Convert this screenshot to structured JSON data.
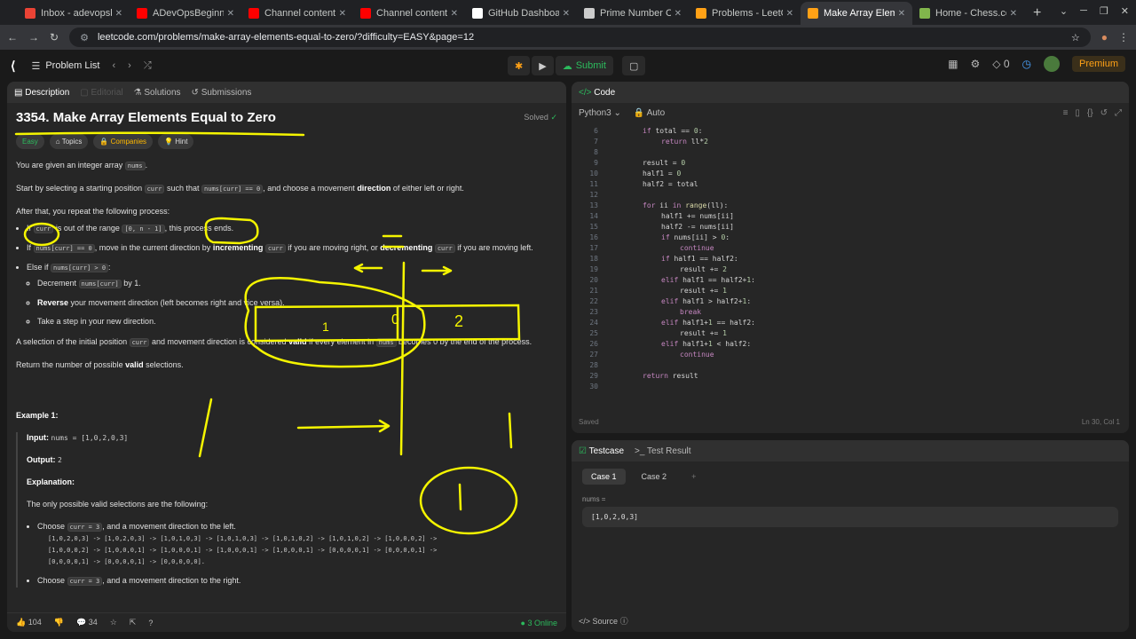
{
  "browser": {
    "tabs": [
      {
        "title": "Inbox - adevopsb",
        "color": "#ea4335"
      },
      {
        "title": "ADevOpsBeginne",
        "color": "#ff0000"
      },
      {
        "title": "Channel content",
        "color": "#ff0000"
      },
      {
        "title": "Channel content",
        "color": "#ff0000"
      },
      {
        "title": "GitHub Dashboar",
        "color": "#ffffff"
      },
      {
        "title": "Prime Number Ch",
        "color": "#cccccc"
      },
      {
        "title": "Problems - LeetC",
        "color": "#ffa116"
      },
      {
        "title": "Make Array Elem",
        "color": "#ffa116"
      },
      {
        "title": "Home - Chess.co",
        "color": "#81b64c"
      }
    ],
    "url": "leetcode.com/problems/make-array-elements-equal-to-zero/?difficulty=EASY&page=12"
  },
  "header": {
    "problem_list": "Problem List",
    "submit": "Submit",
    "notif_count": "0",
    "premium": "Premium"
  },
  "left_tabs": {
    "description": "Description",
    "editorial": "Editorial",
    "solutions": "Solutions",
    "submissions": "Submissions"
  },
  "problem": {
    "title": "3354. Make Array Elements Equal to Zero",
    "solved": "Solved",
    "difficulty": "Easy",
    "topics": "Topics",
    "companies": "Companies",
    "hint": "Hint",
    "p1": "You are given an integer array",
    "p2a": "Start by selecting a starting position",
    "p2b": "such that",
    "p2c": ", and choose a movement",
    "p2d": "direction",
    "p2e": "of either left or right.",
    "p3": "After that, you repeat the following process:",
    "b1a": "is out of the range",
    "b1b": ", this process ends.",
    "b2a": "If",
    "b2b": ", move in the current direction by",
    "b2c": "incrementing",
    "b2d": "if you are moving right, or",
    "b2e": "decrementing",
    "b2f": "if you are moving left.",
    "b3": "Else if",
    "b3_1a": "Decrement",
    "b3_1b": "by 1.",
    "b3_2a": "Reverse",
    "b3_2b": "your movement direction (left becomes right and vice versa).",
    "b3_3": "Take a step in your new direction.",
    "p4a": "A selection of the initial position",
    "p4b": "and movement direction is considered",
    "p4c": "valid",
    "p4d": "if every element in",
    "p4e": "becomes 0 by the end of the process.",
    "p5a": "Return the number of possible",
    "p5b": "valid",
    "p5c": "selections.",
    "code_nums": "nums",
    "code_curr": "curr",
    "code_eq0": "nums[curr] == 0",
    "code_range": "[0, n - 1]",
    "code_gt0": "nums[curr] > 0",
    "code_numscurr": "nums[curr]",
    "example_title": "Example 1:",
    "input_label": "Input:",
    "input_val": "nums = [1,0,2,0,3]",
    "output_label": "Output:",
    "output_val": "2",
    "expl_label": "Explanation:",
    "expl_text": "The only possible valid selections are the following:",
    "choose1a": "Choose",
    "choose_curr": "curr = 3",
    "choose1b": ", and a movement direction to the left.",
    "seq1": "[1,0,2,0,3] -> [1,0,2,0,3] -> [1,0,1,0,3] -> [1,0,1,0,3] -> [1,0,1,0,2] -> [1,0,1,0,2] -> [1,0,0,0,2] ->",
    "seq2": "[1,0,0,0,2] -> [1,0,0,0,1] -> [1,0,0,0,1] -> [1,0,0,0,1] -> [1,0,0,0,1] -> [0,0,0,0,1] -> [0,0,0,0,1] ->",
    "seq3": "[0,0,0,0,1] -> [0,0,0,0,1] -> [0,0,0,0,0].",
    "choose2b": ", and a movement direction to the right."
  },
  "left_footer": {
    "likes": "104",
    "comments": "34",
    "online": "3 Online"
  },
  "code_panel": {
    "title": "Code",
    "language": "Python3",
    "auto": "Auto",
    "status": "Saved",
    "position": "Ln 30, Col 1",
    "lines": [
      {
        "n": "6",
        "indent": 0,
        "text": "if total == 0:"
      },
      {
        "n": "7",
        "indent": 1,
        "text": "return ll*2"
      },
      {
        "n": "8",
        "indent": 0,
        "text": ""
      },
      {
        "n": "9",
        "indent": 0,
        "text": "result = 0"
      },
      {
        "n": "10",
        "indent": 0,
        "text": "half1 = 0"
      },
      {
        "n": "11",
        "indent": 0,
        "text": "half2 = total"
      },
      {
        "n": "12",
        "indent": 0,
        "text": ""
      },
      {
        "n": "13",
        "indent": 0,
        "text": "for ii in range(ll):"
      },
      {
        "n": "14",
        "indent": 1,
        "text": "half1 += nums[ii]"
      },
      {
        "n": "15",
        "indent": 1,
        "text": "half2 -= nums[ii]"
      },
      {
        "n": "16",
        "indent": 1,
        "text": "if nums[ii] > 0:"
      },
      {
        "n": "17",
        "indent": 2,
        "text": "continue"
      },
      {
        "n": "18",
        "indent": 1,
        "text": "if half1 == half2:"
      },
      {
        "n": "19",
        "indent": 2,
        "text": "result += 2"
      },
      {
        "n": "20",
        "indent": 1,
        "text": "elif half1 == half2+1:"
      },
      {
        "n": "21",
        "indent": 2,
        "text": "result += 1"
      },
      {
        "n": "22",
        "indent": 1,
        "text": "elif half1 > half2+1:"
      },
      {
        "n": "23",
        "indent": 2,
        "text": "break"
      },
      {
        "n": "24",
        "indent": 1,
        "text": "elif half1+1 == half2:"
      },
      {
        "n": "25",
        "indent": 2,
        "text": "result += 1"
      },
      {
        "n": "26",
        "indent": 1,
        "text": "elif half1+1 < half2:"
      },
      {
        "n": "27",
        "indent": 2,
        "text": "continue"
      },
      {
        "n": "28",
        "indent": 0,
        "text": ""
      },
      {
        "n": "29",
        "indent": 0,
        "text": "return result"
      },
      {
        "n": "30",
        "indent": 0,
        "text": ""
      }
    ]
  },
  "testcase_panel": {
    "testcase_tab": "Testcase",
    "result_tab": "Test Result",
    "case1": "Case 1",
    "case2": "Case 2",
    "var_label": "nums =",
    "var_value": "[1,0,2,0,3]",
    "source": "Source"
  },
  "annotations": {
    "digit1": "1",
    "digit0": "0",
    "digit2": "2",
    "digit_circle": "1",
    "color": "#f5f500"
  }
}
